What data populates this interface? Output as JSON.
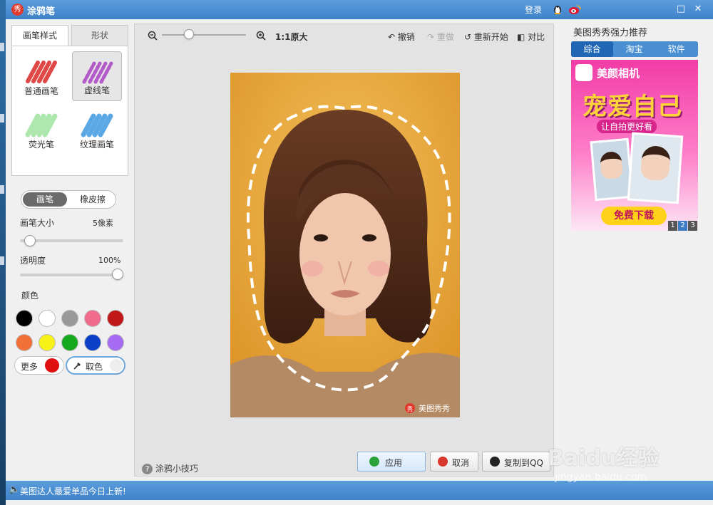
{
  "window": {
    "title": "涂鸦笔",
    "login": "登录",
    "controls": [
      "□",
      "✕"
    ]
  },
  "left_panel": {
    "tabs": [
      {
        "label": "画笔样式",
        "active": true
      },
      {
        "label": "形状",
        "active": false
      }
    ],
    "brushes": [
      {
        "label": "普通画笔",
        "color": "#e04848",
        "selected": false
      },
      {
        "label": "虚线笔",
        "color": "#b45ac8",
        "selected": true
      },
      {
        "label": "荧光笔",
        "color": "#9fe39f",
        "selected": false
      },
      {
        "label": "纹理画笔",
        "color": "#5aa8e6",
        "selected": false
      }
    ],
    "mode_toggle": {
      "on": "画笔",
      "off": "橡皮擦"
    },
    "size": {
      "label": "画笔大小",
      "value": "5像素",
      "fraction": 0.05
    },
    "opacity": {
      "label": "透明度",
      "value": "100%",
      "fraction": 1.0
    },
    "color_label": "颜色",
    "swatches": [
      "#000000",
      "#ffffff",
      "#999999",
      "#f06b8c",
      "#c01818",
      "#f07038",
      "#f6f218",
      "#16a91e",
      "#0b3fc7",
      "#a66bf3"
    ],
    "more_label": "更多",
    "more_color": "#e01010",
    "picker_label": "取色"
  },
  "toolbar": {
    "zoom_level": "1:1原大",
    "zoom_fraction": 0.3,
    "undo": "撤销",
    "redo": "重做",
    "restart": "重新开始",
    "compare": "对比"
  },
  "photo": {
    "watermark": "美图秀秀"
  },
  "footer": {
    "tips": "涂鸦小技巧",
    "apply": "应用",
    "cancel": "取消",
    "copy_qq": "复制到QQ"
  },
  "right_panel": {
    "title": "美图秀秀强力推荐",
    "tabs": [
      {
        "label": "综合",
        "active": true
      },
      {
        "label": "淘宝",
        "active": false
      },
      {
        "label": "软件",
        "active": false
      }
    ],
    "ad": {
      "app_name": "美颜相机",
      "headline": "宠爱自己",
      "subline": "让自拍更好看",
      "cta": "免费下载",
      "pages": [
        "1",
        "2",
        "3"
      ]
    }
  },
  "statusbar": {
    "message": "美图达人最爱单品今日上新!"
  },
  "watermark": {
    "brand": "Baidu经验",
    "url": "jingyan.baidu.com"
  }
}
